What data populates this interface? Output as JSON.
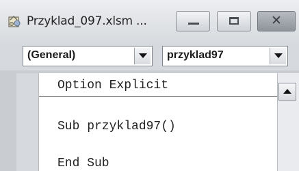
{
  "window": {
    "title": "Przyklad_097.xlsm ...",
    "icon": "vba-module-icon",
    "buttons": {
      "minimize_icon": "minimize-icon",
      "maximize_icon": "maximize-icon",
      "close_label": "✕"
    }
  },
  "combos": {
    "object": {
      "value": "(General)"
    },
    "procedure": {
      "value": "przyklad97"
    }
  },
  "code": {
    "lines": [
      "Option Explicit",
      "Sub przyklad97()",
      "End Sub"
    ]
  }
}
